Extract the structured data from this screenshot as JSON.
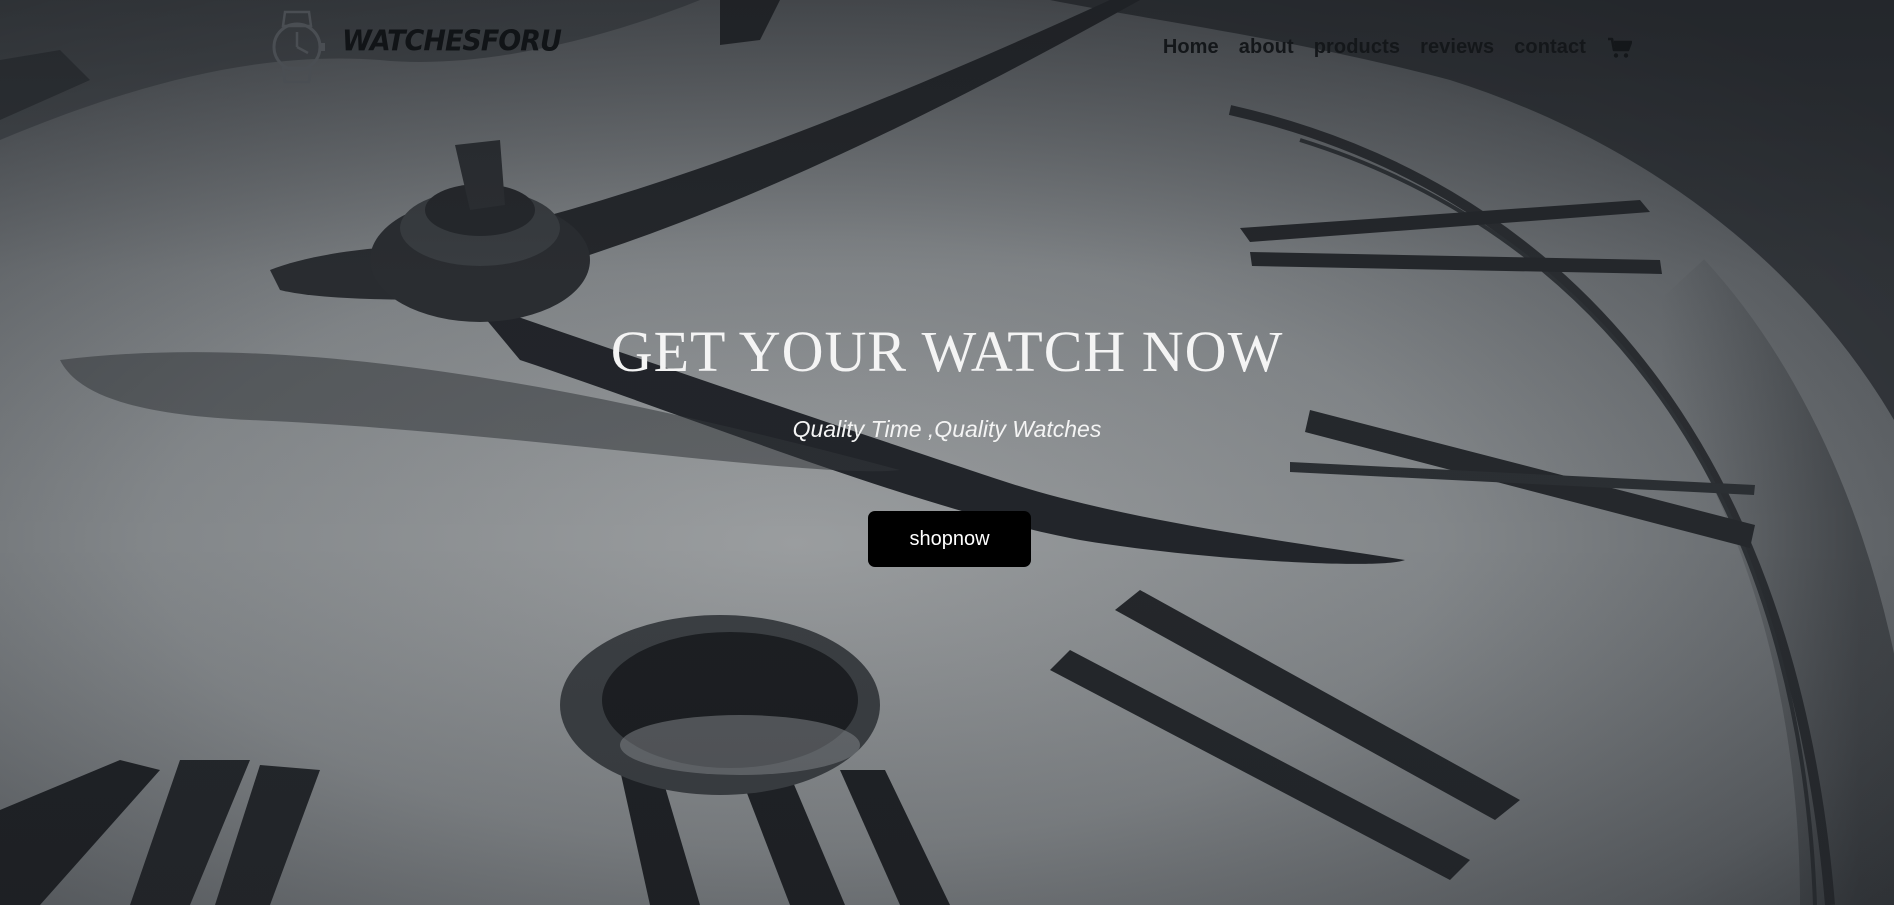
{
  "header": {
    "logo_text": "WATCHESFORU",
    "logo_icon": "watch-icon",
    "nav": [
      {
        "label": "Home"
      },
      {
        "label": "about"
      },
      {
        "label": "products"
      },
      {
        "label": "reviews"
      },
      {
        "label": "contact"
      }
    ],
    "cart_icon": "shopping-cart-icon"
  },
  "hero": {
    "title": "GET YOUR WATCH NOW",
    "subtitle": "Quality Time ,Quality Watches",
    "button_label": "shopnow",
    "background": "clock-face-photo"
  },
  "colors": {
    "nav_text": "#14171a",
    "hero_text": "#f4f4f4",
    "button_bg": "#000000",
    "button_text": "#ffffff"
  }
}
